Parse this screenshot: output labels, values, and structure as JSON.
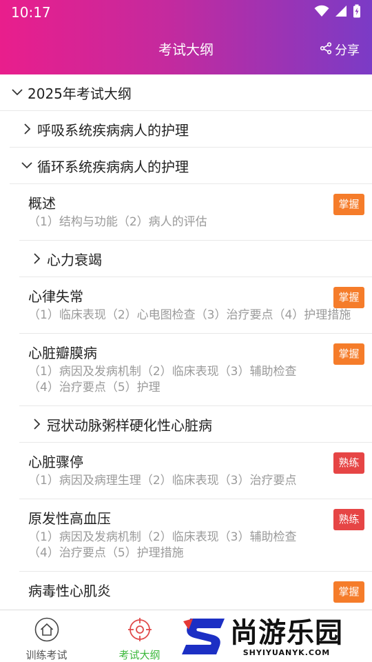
{
  "status_bar": {
    "time": "10:17"
  },
  "header": {
    "title": "考试大纲",
    "share_label": "分享"
  },
  "outline": {
    "year_title": "2025年考试大纲",
    "section_respiratory": "呼吸系统疾病病人的护理",
    "section_circulatory": "循环系统疾病病人的护理",
    "items": [
      {
        "title": "概述",
        "desc": "（1）结构与功能（2）病人的评估",
        "badge": "掌握"
      },
      {
        "title": "心力衰竭"
      },
      {
        "title": "心律失常",
        "desc": "（1）临床表现（2）心电图检查（3）治疗要点（4）护理措施",
        "badge": "掌握"
      },
      {
        "title": "心脏瓣膜病",
        "desc": "（1）病因及发病机制（2）临床表现（3）辅助检查（4）治疗要点（5）护理",
        "badge": "掌握"
      },
      {
        "title": "冠状动脉粥样硬化性心脏病"
      },
      {
        "title": "心脏骤停",
        "desc": "（1）病因及病理生理（2）临床表现（3）治疗要点",
        "badge": "熟练"
      },
      {
        "title": "原发性高血压",
        "desc": "（1）病因及发病机制（2）临床表现（3）辅助检查（4）治疗要点（5）护理措施",
        "badge": "熟练"
      },
      {
        "title": "病毒性心肌炎",
        "badge": "掌握"
      }
    ]
  },
  "bottom_nav": {
    "training": "训练考试",
    "outline": "考试大纲",
    "active_color": "#3cb83c",
    "inactive_color": "#555555"
  },
  "watermark": {
    "cn": "尚游乐园",
    "en": "SHYIYUANYK.COM"
  }
}
